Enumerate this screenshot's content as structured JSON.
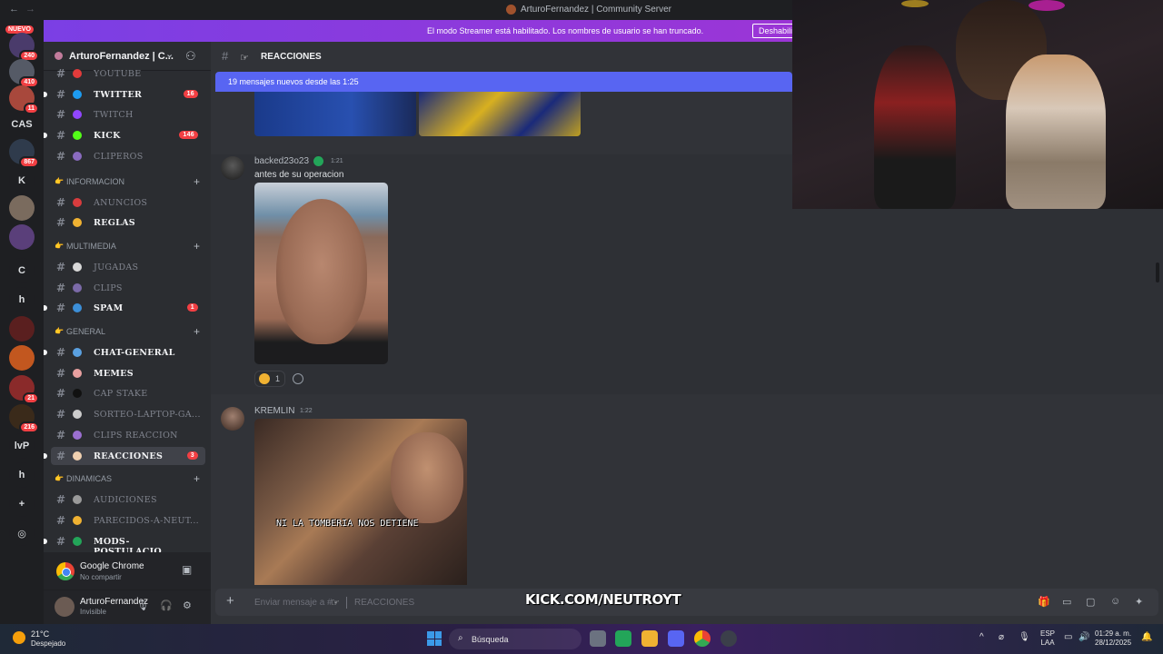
{
  "window": {
    "title": "ArturoFernandez | Community Server",
    "back": "←",
    "forward": "→"
  },
  "rail": {
    "new_badge": "NUEVO",
    "servers": [
      {
        "label": "",
        "badge": "240",
        "color": "#4a3b6b"
      },
      {
        "label": "",
        "badge": "410",
        "color": "#555a66"
      },
      {
        "label": "",
        "badge": "11",
        "color": "#a8483c"
      },
      {
        "label": "CAS",
        "badge": "",
        "color": "#1e1f22"
      },
      {
        "label": "",
        "badge": "867",
        "color": "#2f3b4c"
      },
      {
        "label": "K",
        "badge": "",
        "color": "#1e1f22"
      },
      {
        "label": "",
        "badge": "",
        "color": "#7a6b5e"
      },
      {
        "label": "",
        "badge": "",
        "color": "#5a3f7a"
      },
      {
        "label": "C",
        "badge": "",
        "color": "#1e1f22"
      },
      {
        "label": "h",
        "badge": "",
        "color": "#1e1f22"
      },
      {
        "label": "",
        "badge": "",
        "color": "#5a1f1f"
      },
      {
        "label": "",
        "badge": "",
        "color": "#c2571f"
      },
      {
        "label": "",
        "badge": "21",
        "color": "#8a2a2a"
      },
      {
        "label": "",
        "badge": "216",
        "color": "#3a2a1a"
      },
      {
        "label": "lvP",
        "badge": "",
        "color": "#1e1f22"
      },
      {
        "label": "h",
        "badge": "",
        "color": "#1e1f22"
      },
      {
        "label": "+",
        "badge": "",
        "color": "#1e1f22"
      },
      {
        "label": "◎",
        "badge": "",
        "color": "#1e1f22"
      }
    ]
  },
  "banner": {
    "text": "El modo Streamer está habilitado. Los nombres de usuario se han truncado.",
    "button": "Deshabilitar"
  },
  "guild": {
    "name": "ArturoFernandez | C...",
    "chevron": "⌄",
    "invite_icon": "⚇"
  },
  "channels_top": [
    {
      "label": "YOUTUBE",
      "badge": "",
      "state": "muted",
      "emoji_color": "#e23b3b",
      "dot": false
    },
    {
      "label": "TWITTER",
      "badge": "16",
      "state": "unread",
      "emoji_color": "#1d9bf0",
      "dot": true
    },
    {
      "label": "TWITCH",
      "badge": "",
      "state": "muted",
      "emoji_color": "#9146ff",
      "dot": false
    },
    {
      "label": "KICK",
      "badge": "146",
      "state": "unread",
      "emoji_color": "#53fc18",
      "dot": true
    },
    {
      "label": "CLIPEROS",
      "badge": "",
      "state": "muted",
      "emoji_color": "#8a6bbf",
      "dot": false
    }
  ],
  "categories": [
    {
      "name": "INFORMACION",
      "channels": [
        {
          "label": "ANUNCIOS",
          "badge": "",
          "state": "muted",
          "emoji_color": "#d83c3e",
          "dot": false
        },
        {
          "label": "REGLAS",
          "badge": "",
          "state": "unread",
          "emoji_color": "#f0b232",
          "dot": false
        }
      ]
    },
    {
      "name": "MULTIMEDIA",
      "channels": [
        {
          "label": "JUGADAS",
          "badge": "",
          "state": "muted",
          "emoji_color": "#d9d9d9",
          "dot": false
        },
        {
          "label": "CLIPS",
          "badge": "",
          "state": "muted",
          "emoji_color": "#7b6aa8",
          "dot": false
        },
        {
          "label": "SPAM",
          "badge": "1",
          "state": "unread",
          "emoji_color": "#3c8fd8",
          "dot": true
        }
      ]
    },
    {
      "name": "GENERAL",
      "channels": [
        {
          "label": "CHAT-GENERAL",
          "badge": "",
          "state": "unread",
          "emoji_color": "#5aa0e0",
          "dot": true
        },
        {
          "label": "MEMES",
          "badge": "",
          "state": "unread",
          "emoji_color": "#e8a0a0",
          "dot": false
        },
        {
          "label": "CAP  STAKE",
          "badge": "",
          "state": "muted",
          "emoji_color": "#111111",
          "dot": false
        },
        {
          "label": "SORTEO-LAPTOP-GA...",
          "badge": "",
          "state": "muted",
          "emoji_color": "#cccccc",
          "dot": false
        },
        {
          "label": "CLIPS  REACCION",
          "badge": "",
          "state": "muted",
          "emoji_color": "#9b6fd1",
          "dot": false
        },
        {
          "label": "REACCIONES",
          "badge": "3",
          "state": "active",
          "emoji_color": "#f0d0b0",
          "dot": true
        }
      ]
    },
    {
      "name": "DINAMICAS",
      "channels": [
        {
          "label": "AUDICIONES",
          "badge": "",
          "state": "muted",
          "emoji_color": "#9a9a9a",
          "dot": false
        },
        {
          "label": "PARECIDOS-A-NEUT...",
          "badge": "",
          "state": "muted",
          "emoji_color": "#f0b232",
          "dot": false
        },
        {
          "label": "MODS-POSTULACIO...",
          "badge": "",
          "state": "unread",
          "emoji_color": "#23a559",
          "dot": true
        }
      ]
    }
  ],
  "voice": {
    "name": "Google Chrome",
    "sub": "No compartir",
    "icon": "screen-share-icon"
  },
  "user": {
    "name": "ArturoFernandez",
    "status": "Invisible"
  },
  "chat": {
    "channel": "REACCIONES",
    "header_hash": "#",
    "new_messages": "19 mensajes nuevos desde las 1:25",
    "messages": [
      {
        "author": "backed23o23",
        "time": "1:21",
        "text": "antes de su operacion",
        "reaction_count": "1"
      },
      {
        "author": "KREMLIN",
        "time": "1:22",
        "text": "",
        "caption": "NI LA TOMBERIA NOS DETIENE"
      }
    ],
    "composer_placeholder": "Enviar mensaje a #",
    "composer_channel": "REACCIONES"
  },
  "overlay": {
    "kick": "KICK.COM/NEUTROYT"
  },
  "taskbar": {
    "temp": "21°C",
    "weather": "Despejado",
    "search": "Búsqueda",
    "lang1": "ESP",
    "lang2": "LAA",
    "time": "01:29 a. m.",
    "date": "28/12/2025"
  }
}
